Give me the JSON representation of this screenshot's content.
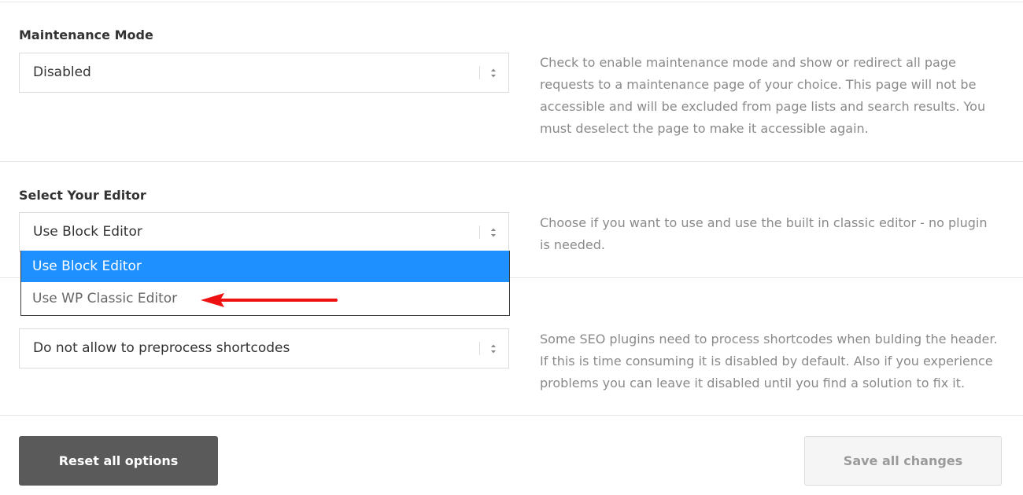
{
  "maintenance": {
    "title": "Maintenance Mode",
    "value": "Disabled",
    "description": "Check to enable maintenance mode and show or redirect all page requests to a maintenance page of your choice. This page will not be accessible and will be excluded from page lists and search results. You must deselect the page to make it accessible again."
  },
  "editor": {
    "title": "Select Your Editor",
    "value": "Use Block Editor",
    "description": "Choose if you want to use and use the built in classic editor - no plugin is needed.",
    "options": [
      "Use Block Editor",
      "Use WP Classic Editor"
    ]
  },
  "shortcodes": {
    "value": "Do not allow to preprocess shortcodes",
    "description": "Some SEO plugins need to process shortcodes when bulding the header. If this is time consuming it is disabled by default. Also if you experience problems you can leave it disabled until you find a solution to fix it."
  },
  "buttons": {
    "reset_label": "Reset all options",
    "save_label": "Save all changes"
  },
  "colors": {
    "highlight": "#1e90ff",
    "annotation_arrow": "#ee1111",
    "reset_button": "#5a5a5a"
  }
}
